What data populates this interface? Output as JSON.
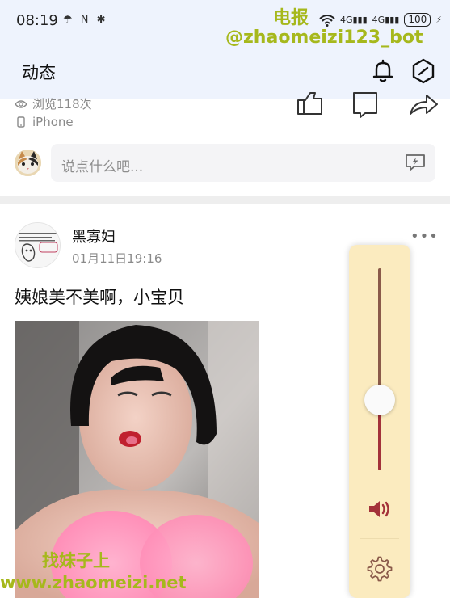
{
  "status_bar": {
    "time": "08:19",
    "small_icons": "☂ N ✱",
    "signal_1": "4G",
    "signal_2": "4G",
    "battery": "100"
  },
  "header": {
    "title": "动态"
  },
  "watermarks": {
    "top_line1": "电报",
    "top_line2": "@zhaomeizi123_bot",
    "bottom_line1": "找妹子上",
    "bottom_line2": "www.zhaomeizi.net"
  },
  "prev_post": {
    "views": "浏览118次",
    "device": "iPhone"
  },
  "comment": {
    "placeholder": "说点什么吧..."
  },
  "post": {
    "author": "黑寡妇",
    "time": "01月11日19:16",
    "text": "姨娘美不美啊，小宝贝",
    "more": "•••"
  },
  "volume": {
    "level": 0.35,
    "accent_color": "#a3323a",
    "panel_color": "#fbebbf"
  }
}
